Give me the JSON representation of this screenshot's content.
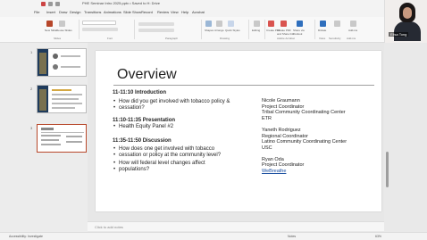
{
  "window": {
    "title": "PHE Seminar Intro 2025.pptx • Saved to H: Drive"
  },
  "tabs": [
    "File",
    "Insert",
    "Draw",
    "Design",
    "Transitions",
    "Animations",
    "Slide Show",
    "Record",
    "Review",
    "View",
    "Help",
    "Acrobat"
  ],
  "ribbon": {
    "record_label": "Record",
    "buttons": [
      {
        "label": "New Slide"
      },
      {
        "label": "Reuse Slides"
      },
      {
        "label": "Shapes"
      },
      {
        "label": "Arrange"
      },
      {
        "label": "Quick Styles"
      },
      {
        "label": "Editing"
      },
      {
        "label": "Create PDF"
      },
      {
        "label": "Create PDF and Share link"
      },
      {
        "label": "Share via Outlook"
      },
      {
        "label": "Dictate"
      },
      {
        "label": "Add-ins"
      }
    ],
    "groups": [
      "Slides",
      "Font",
      "Paragraph",
      "Drawing",
      "Adobe Acrobat",
      "Voice",
      "Sensitivity",
      "Add-ins"
    ]
  },
  "webcam": {
    "name": "Elisa Tong"
  },
  "thumbnails": [
    {
      "number": "1",
      "selected": false
    },
    {
      "number": "2",
      "selected": false
    },
    {
      "number": "3",
      "selected": true
    }
  ],
  "slide": {
    "title": "Overview",
    "agenda": [
      {
        "time": "11-11:10  Introduction",
        "bullets": [
          "How did you get involved with tobacco policy &",
          "cessation?"
        ]
      },
      {
        "time": "11:10-11:35  Presentation",
        "bullets": [
          "Health Equity Panel #2"
        ]
      },
      {
        "time": "11:35-11:50 Discussion",
        "bullets": [
          "How does one get involved with tobacco",
          "cessation or policy at the community level?",
          "How will federal level changes affect",
          "populations?"
        ]
      }
    ],
    "speakers": [
      {
        "lines": [
          "Nicole Graumann",
          "Project Coordinator",
          "Tribal Community Coordinating Center",
          "ETR"
        ]
      },
      {
        "lines": [
          "Yaneth Rodriguez",
          "Regional Coordinator",
          "Latino Community Coordinating Center",
          "USC"
        ]
      },
      {
        "lines": [
          "Ryan Oda",
          "Project Coordinator"
        ],
        "link": "WeBreathe"
      }
    ]
  },
  "notes": {
    "placeholder": "Click to add notes"
  },
  "status": {
    "accessibility": "Accessibility: Investigate",
    "notes": "Notes",
    "zoom": "63%"
  }
}
